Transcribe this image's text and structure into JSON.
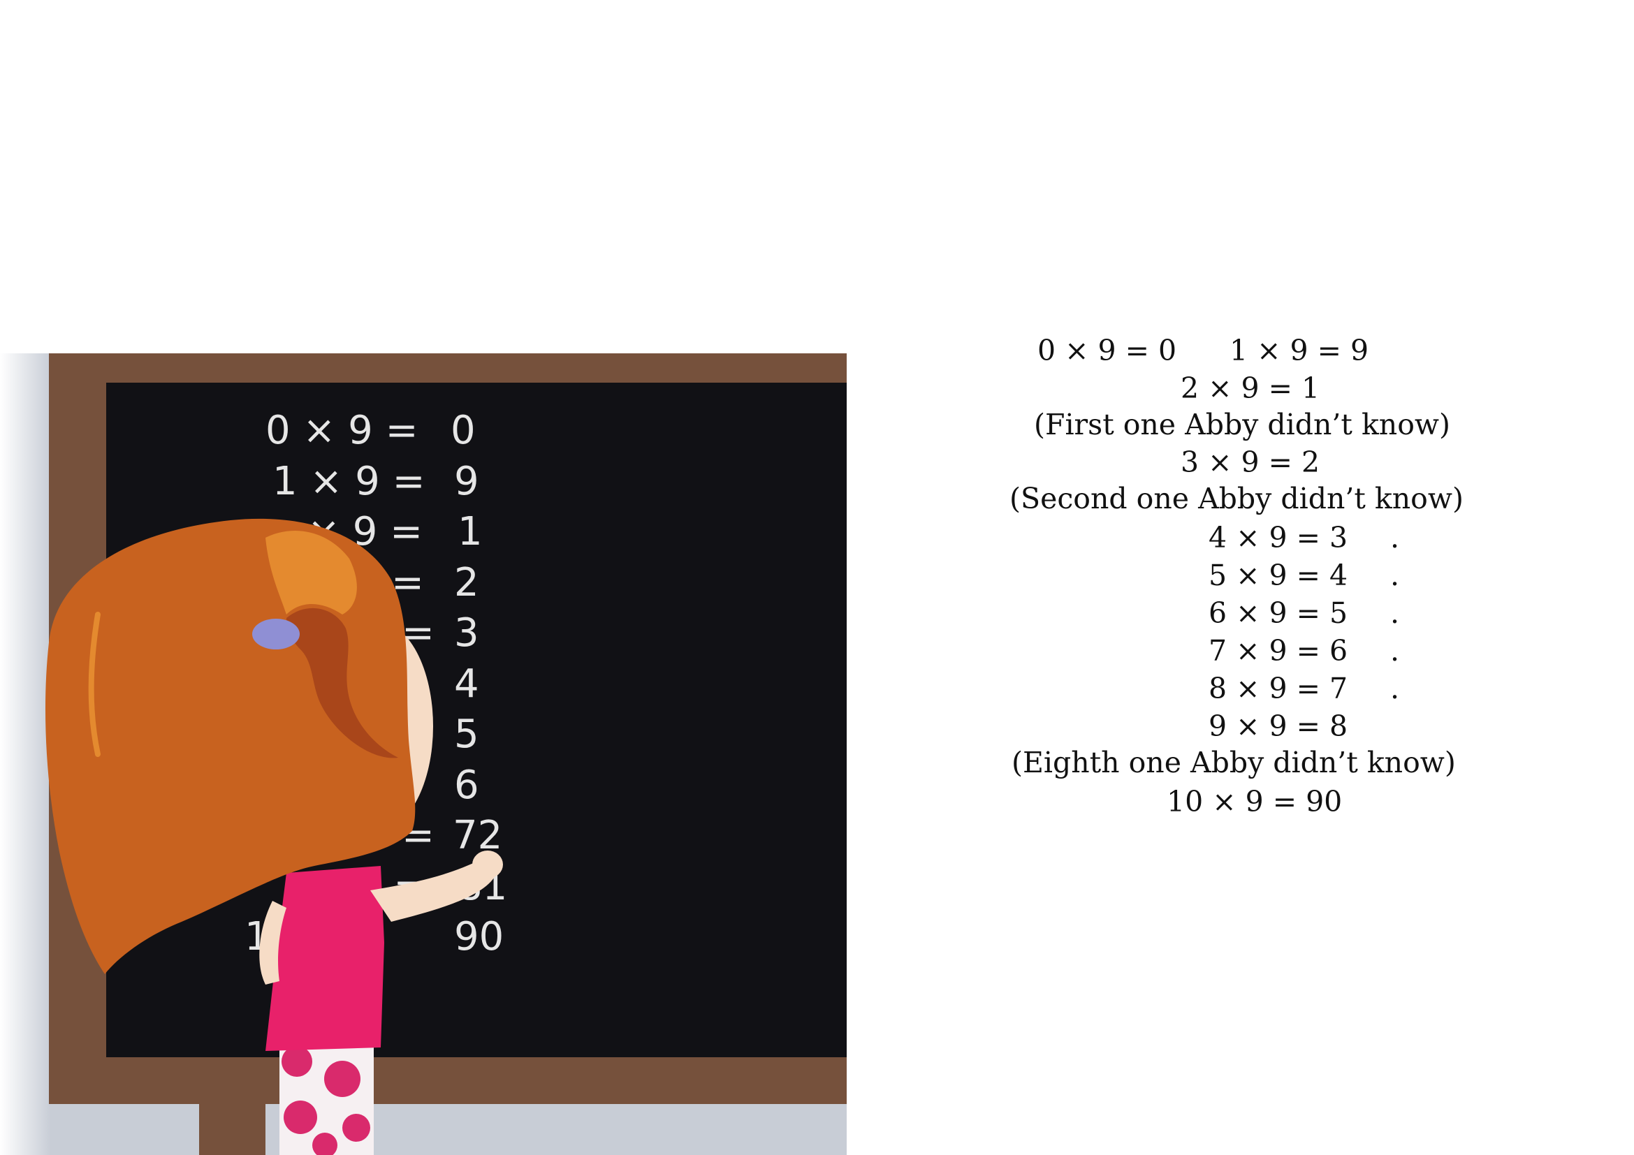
{
  "colors": {
    "background": "#ffffff",
    "board_frame": "#76513c",
    "board_surface": "#111115",
    "chalk": "#e6e6e6",
    "wall": "#c8cdd6",
    "floor": "#c9ccd3",
    "hair": "#c8621f",
    "hair_highlight": "#e48a2f",
    "hair_shadow": "#a9461a",
    "skin": "#f6dcc6",
    "dress": "#e8216a",
    "pants": "#f6f0f2",
    "pants_dots": "#d92a6c",
    "hair_clip": "#8f8fd4",
    "text": "#111111"
  },
  "chalkboard": {
    "lines": [
      {
        "eq": "0 × 9 =",
        "ans": "0"
      },
      {
        "eq": "1 × 9 =",
        "ans": "9"
      },
      {
        "eq": "× 9 =",
        "ans": "1"
      },
      {
        "eq": "=",
        "ans": "2"
      },
      {
        "eq": "=",
        "ans": "3"
      },
      {
        "eq": "",
        "ans": "4"
      },
      {
        "eq": "",
        "ans": "5"
      },
      {
        "eq": "",
        "ans": "6"
      },
      {
        "eq": "=",
        "ans": "72"
      },
      {
        "eq": "9 =",
        "ans": "81"
      },
      {
        "eq": "1 =",
        "ans": "90"
      }
    ]
  },
  "story": {
    "line1a": "0 × 9 = 0",
    "line1b": "1 × 9 = 9",
    "line2": "2 × 9 = 1",
    "note1": "(First one Abby didn’t know)",
    "line3": "3 × 9 = 2",
    "note2": "(Second one Abby didn’t know)",
    "line4": "4 × 9 = 3",
    "line5": "5 × 9 = 4",
    "line6": "6 × 9 = 5",
    "line7": "7 × 9 = 6",
    "line8": "8 × 9 = 7",
    "line9": "9 × 9 = 8",
    "note3": "(Eighth one Abby didn’t know)",
    "line10": "10 × 9 = 90",
    "dot": "."
  }
}
